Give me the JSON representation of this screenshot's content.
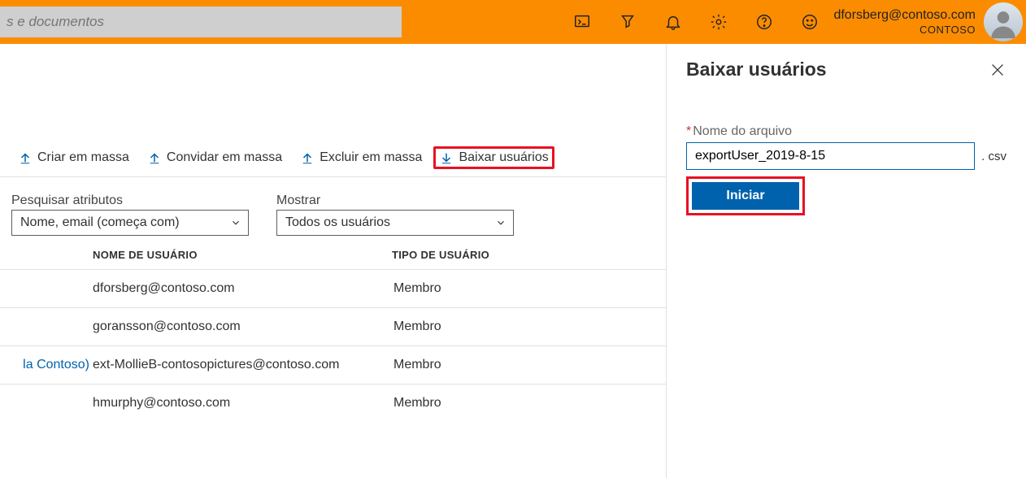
{
  "header": {
    "search_placeholder": "s e documentos",
    "user_email": "dforsberg@contoso.com",
    "user_org": "CONTOSO"
  },
  "toolbar": {
    "bulk_create": "Criar em massa",
    "bulk_invite": "Convidar em massa",
    "bulk_delete": "Excluir em massa",
    "download_users": "Baixar usuários"
  },
  "filters": {
    "search_label": "Pesquisar atributos",
    "search_value": "Nome, email (começa com)",
    "show_label": "Mostrar",
    "show_value": "Todos os usuários"
  },
  "table": {
    "col_user": "NOME DE USUÁRIO",
    "col_type": "TIPO DE USUÁRIO",
    "rows": [
      {
        "tag": "",
        "username": "dforsberg@contoso.com",
        "type": "Membro"
      },
      {
        "tag": "",
        "username": "goransson@contoso.com",
        "type": "Membro"
      },
      {
        "tag": "la Contoso)",
        "username": "ext-MollieB-contosopictures@contoso.com",
        "type": "Membro"
      },
      {
        "tag": "",
        "username": "hmurphy@contoso.com",
        "type": "Membro"
      }
    ]
  },
  "panel": {
    "title": "Baixar usuários",
    "filename_label": "Nome do arquivo",
    "filename_value": "exportUser_2019-8-15",
    "extension": ". csv",
    "start_label": "Iniciar"
  }
}
